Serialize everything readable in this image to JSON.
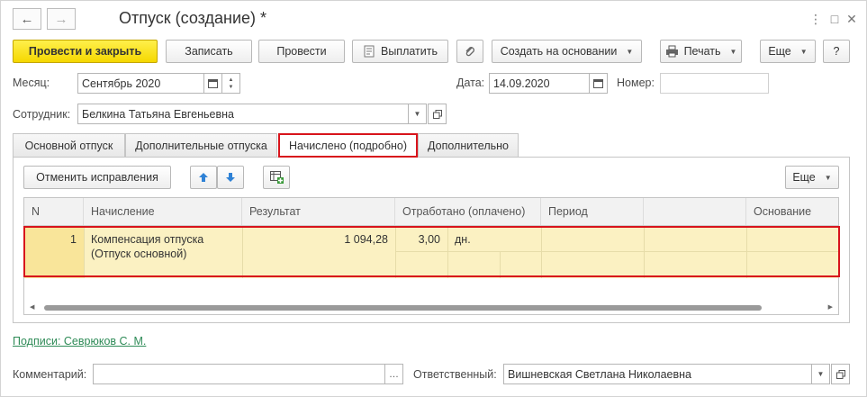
{
  "window": {
    "title": "Отпуск (создание) *",
    "back_glyph": "🡐",
    "forward_glyph": "🡒"
  },
  "toolbar": {
    "post_close": "Провести и закрыть",
    "save": "Записать",
    "post": "Провести",
    "pay": "Выплатить",
    "create_based": "Создать на основании",
    "print": "Печать",
    "more": "Еще",
    "help": "?"
  },
  "fields": {
    "month_label": "Месяц:",
    "month_value": "Сентябрь 2020",
    "date_label": "Дата:",
    "date_value": "14.09.2020",
    "number_label": "Номер:",
    "number_value": "",
    "employee_label": "Сотрудник:",
    "employee_value": "Белкина Татьяна Евгеньевна"
  },
  "tabs": [
    {
      "label": "Основной отпуск"
    },
    {
      "label": "Дополнительные отпуска"
    },
    {
      "label": "Начислено (подробно)"
    },
    {
      "label": "Дополнительно"
    }
  ],
  "panel": {
    "cancel_corrections": "Отменить исправления",
    "more": "Еще"
  },
  "grid": {
    "columns": [
      "N",
      "Начисление",
      "Результат",
      "Отработано (оплачено)",
      "Период",
      "",
      "Основание"
    ],
    "rows": [
      {
        "n": "1",
        "accrual_line1": "Компенсация отпуска",
        "accrual_line2": "(Отпуск основной)",
        "result": "1 094,28",
        "worked": "3,00",
        "unit": "дн."
      }
    ]
  },
  "footer": {
    "signatures_link": "Подписи: Севрюков С. М.",
    "comment_label": "Комментарий:",
    "comment_value": "",
    "responsible_label": "Ответственный:",
    "responsible_value": "Вишневская Светлана Николаевна"
  },
  "colors": {
    "primary_button": "#f5d800",
    "highlight": "#d8141c",
    "row_bg": "#fbf1c2",
    "link": "#2e8b57"
  }
}
